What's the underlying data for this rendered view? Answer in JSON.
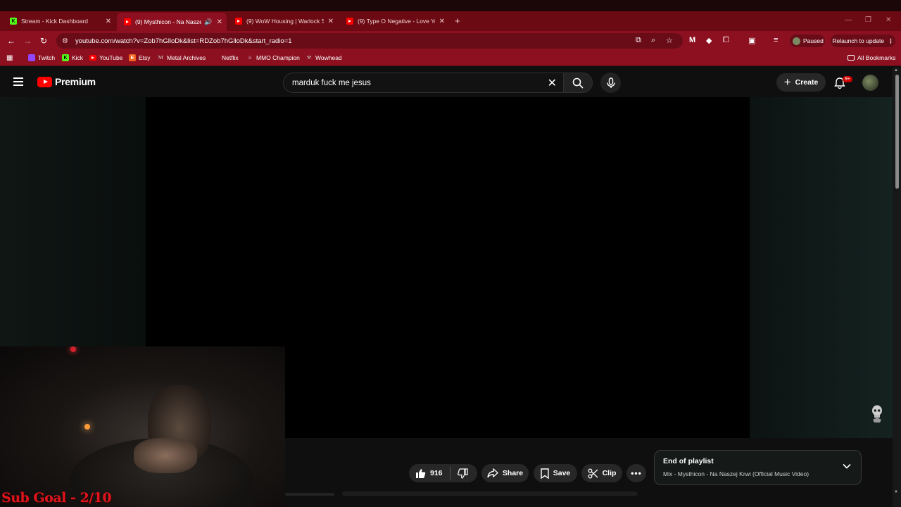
{
  "browser": {
    "tabs": [
      {
        "title": "Stream - Kick Dashboard",
        "icon": "kick-icon",
        "active": false
      },
      {
        "title": "(9) Mysthicon - Na Naszej K",
        "icon": "youtube-icon",
        "active": true
      },
      {
        "title": "(9) WoW Housing | Warlock Sa",
        "icon": "youtube-icon",
        "active": false
      },
      {
        "title": "(9) Type O Negative - Love You",
        "icon": "youtube-icon",
        "active": false
      }
    ],
    "new_tab": "+",
    "url": "youtube.com/watch?v=Zob7hGlloDk&list=RDZob7hGlloDk&start_radio=1",
    "profile_status": "Paused",
    "relaunch_label": "Relaunch to update",
    "bookmarks": [
      {
        "label": "Twitch",
        "color": "#9146ff"
      },
      {
        "label": "Kick",
        "color": "#53fc18"
      },
      {
        "label": "YouTube",
        "color": "#ff0000"
      },
      {
        "label": "Etsy",
        "color": "#f1641e"
      },
      {
        "label": "Metal Archives",
        "color": "#cccccc"
      },
      {
        "label": "Netflix",
        "color": "#e50914"
      },
      {
        "label": "MMO Champion",
        "color": "#cccccc"
      },
      {
        "label": "Wowhead",
        "color": "#cccccc"
      }
    ],
    "all_bookmarks": "All Bookmarks"
  },
  "youtube": {
    "logo_text": "Premium",
    "search_query": "marduk fuck me jesus",
    "create_label": "Create",
    "notification_badge": "9+",
    "actions": {
      "likes": "916",
      "share": "Share",
      "save": "Save",
      "clip": "Clip"
    },
    "playlist": {
      "title": "End of playlist",
      "subtitle": "Mix - Mysthicon - Na Naszej Krwi (Official Music Video)"
    }
  },
  "overlay": {
    "sub_goal": "Sub Goal - 2/10"
  },
  "colors": {
    "chrome_red": "#8c1020",
    "youtube_red": "#ff0000",
    "sub_goal_red": "#e0141c"
  }
}
